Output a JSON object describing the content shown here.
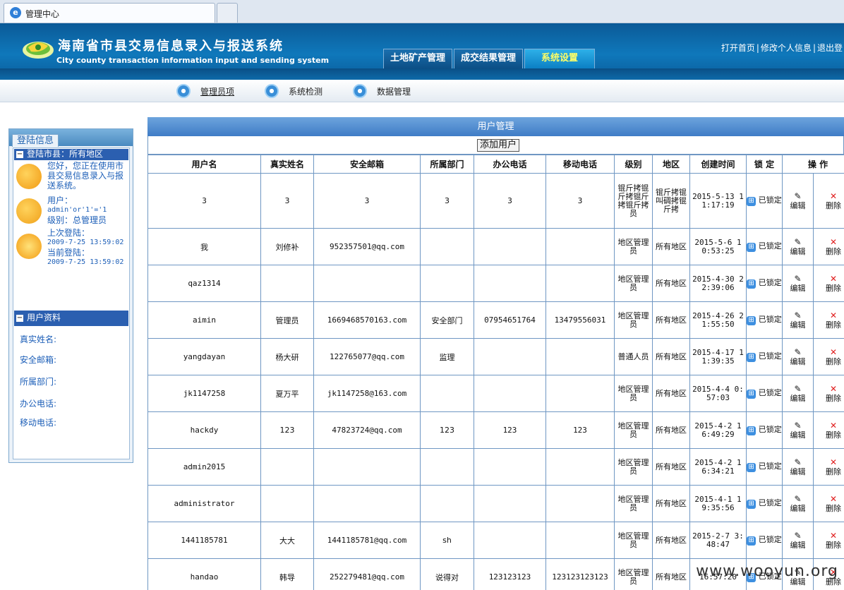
{
  "browser": {
    "tab_title": "管理中心"
  },
  "header": {
    "title": "海南省市县交易信息录入与报送系统",
    "subtitle": "City county transaction information input and sending system",
    "nav": [
      {
        "label": "土地矿产管理"
      },
      {
        "label": "成交结果管理"
      },
      {
        "label": "系统设置"
      }
    ],
    "links": {
      "home": "打开首页",
      "profile": "修改个人信息",
      "logout": "退出登"
    }
  },
  "subnav": [
    {
      "label": "管理员项"
    },
    {
      "label": "系统检测"
    },
    {
      "label": "数据管理"
    }
  ],
  "left": {
    "tab": "登陆信息",
    "section1": "登陆市县：所有地区",
    "welcome": "您好，您正在使用市县交易信息录入与报送系统。",
    "user_label": "用户：",
    "user_value": "admin'or'1'='1",
    "level_label": "级别：总管理员",
    "last_login_label": "上次登陆：",
    "last_login": "2009-7-25 13:59:02",
    "current_login_label": "当前登陆：",
    "current_login": "2009-7-25 13:59:02",
    "section2": "用户资料",
    "fields": [
      "真实姓名:",
      "安全邮箱:",
      "所属部门:",
      "办公电话:",
      "移动电话:"
    ]
  },
  "main": {
    "title": "用户管理",
    "add_button": "添加用户",
    "columns": [
      "用户名",
      "真实姓名",
      "安全邮箱",
      "所属部门",
      "办公电话",
      "移动电话",
      "级别",
      "地区",
      "创建时间",
      "锁 定",
      "操 作"
    ],
    "lock_text": "已锁定",
    "edit_text": "编辑",
    "delete_text": "删除",
    "rows": [
      {
        "username": "3",
        "realname": "3",
        "email": "3",
        "dept": "3",
        "office": "3",
        "mobile": "3",
        "level": "锟斤拷锟斤拷锟斤拷锟斤拷员",
        "area": "锟斤拷锟叫碉拷锟斤拷",
        "created": "2015-5-13 11:17:19"
      },
      {
        "username": "我",
        "realname": "刘修补",
        "email": "952357501@qq.com",
        "dept": "",
        "office": "",
        "mobile": "",
        "level": "地区管理员",
        "area": "所有地区",
        "created": "2015-5-6 10:53:25"
      },
      {
        "username": "qaz1314",
        "realname": "",
        "email": "",
        "dept": "",
        "office": "",
        "mobile": "",
        "level": "地区管理员",
        "area": "所有地区",
        "created": "2015-4-30 22:39:06"
      },
      {
        "username": "aimin",
        "realname": "管理员",
        "email": "1669468570163.com",
        "dept": "安全部门",
        "office": "07954651764",
        "mobile": "13479556031",
        "level": "地区管理员",
        "area": "所有地区",
        "created": "2015-4-26 21:55:50"
      },
      {
        "username": "yangdayan",
        "realname": "杨大研",
        "email": "122765077@qq.com",
        "dept": "监理",
        "office": "",
        "mobile": "",
        "level": "普通人员",
        "area": "所有地区",
        "created": "2015-4-17 11:39:35"
      },
      {
        "username": "jk1147258",
        "realname": "夏万平",
        "email": "jk1147258@163.com",
        "dept": "",
        "office": "",
        "mobile": "",
        "level": "地区管理员",
        "area": "所有地区",
        "created": "2015-4-4 0:57:03"
      },
      {
        "username": "hackdy",
        "realname": "123",
        "email": "47823724@qq.com",
        "dept": "123",
        "office": "123",
        "mobile": "123",
        "level": "地区管理员",
        "area": "所有地区",
        "created": "2015-4-2 16:49:29"
      },
      {
        "username": "admin2015",
        "realname": "",
        "email": "",
        "dept": "",
        "office": "",
        "mobile": "",
        "level": "地区管理员",
        "area": "所有地区",
        "created": "2015-4-2 16:34:21"
      },
      {
        "username": "administrator",
        "realname": "",
        "email": "",
        "dept": "",
        "office": "",
        "mobile": "",
        "level": "地区管理员",
        "area": "所有地区",
        "created": "2015-4-1 19:35:56"
      },
      {
        "username": "1441185781",
        "realname": "大大",
        "email": "1441185781@qq.com",
        "dept": "sh",
        "office": "",
        "mobile": "",
        "level": "地区管理员",
        "area": "所有地区",
        "created": "2015-2-7 3:48:47"
      },
      {
        "username": "handao",
        "realname": "韩导",
        "email": "252279481@qq.com",
        "dept": "说得对",
        "office": "123123123",
        "mobile": "123123123123",
        "level": "地区管理员",
        "area": "所有地区",
        "created": "16:57:20"
      }
    ]
  },
  "watermark": "www.wooyun.org"
}
